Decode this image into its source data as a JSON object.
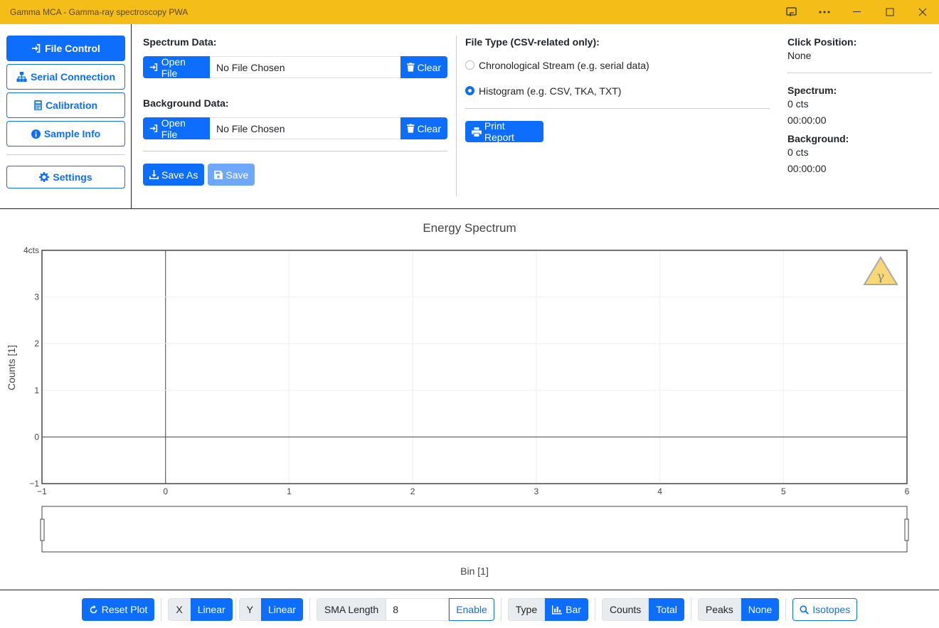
{
  "window": {
    "title": "Gamma MCA - Gamma-ray spectroscopy PWA"
  },
  "nav": {
    "file_control": "File Control",
    "serial_connection": "Serial Connection",
    "calibration": "Calibration",
    "sample_info": "Sample Info",
    "settings": "Settings"
  },
  "file": {
    "spectrum_label": "Spectrum Data:",
    "background_label": "Background Data:",
    "open_label": "Open File",
    "no_file": "No File Chosen",
    "clear_label": "Clear",
    "save_as_label": "Save As",
    "save_label": "Save",
    "file_type_label": "File Type (CSV-related only):",
    "radio_chrono": "Chronological Stream (e.g. serial data)",
    "radio_histogram": "Histogram (e.g. CSV, TKA, TXT)",
    "selected_file_type": "Histogram (e.g. CSV, TKA, TXT)",
    "print_report": "Print Report"
  },
  "info": {
    "click_position_label": "Click Position:",
    "click_position_value": "None",
    "spectrum_label": "Spectrum:",
    "spectrum_counts": "0 cts",
    "spectrum_time": "00:00:00",
    "background_label": "Background:",
    "background_counts": "0 cts",
    "background_time": "00:00:00"
  },
  "chart_data": {
    "type": "bar",
    "title": "Energy Spectrum",
    "xlabel": "Bin [1]",
    "ylabel": "Counts [1]",
    "xlim": [
      -1,
      6
    ],
    "ylim": [
      -1,
      4
    ],
    "x_ticks": [
      "−1",
      "0",
      "1",
      "2",
      "3",
      "4",
      "5",
      "6"
    ],
    "y_ticks": [
      "−1",
      "0",
      "1",
      "2",
      "3",
      "4cts"
    ],
    "series": [],
    "grid": true,
    "range_slider": true
  },
  "toolbar": {
    "reset_plot": "Reset Plot",
    "x_label": "X",
    "x_value": "Linear",
    "y_label": "Y",
    "y_value": "Linear",
    "sma_label": "SMA Length",
    "sma_value": "8",
    "enable_label": "Enable",
    "type_label": "Type",
    "type_value": "Bar",
    "counts_label": "Counts",
    "counts_value": "Total",
    "peaks_label": "Peaks",
    "peaks_value": "None",
    "isotopes_label": "Isotopes"
  },
  "colors": {
    "accent": "#0d6efd",
    "titlebar": "#f5bd18"
  }
}
